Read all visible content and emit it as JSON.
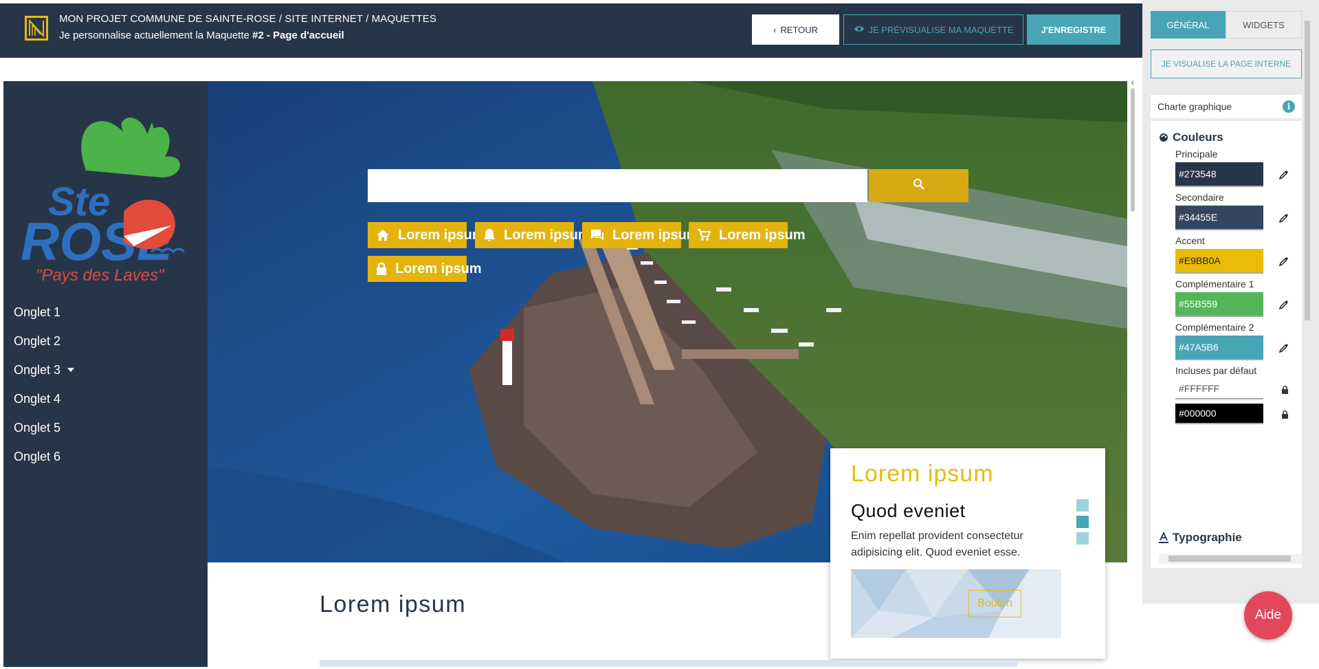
{
  "header": {
    "path": "MON PROJET COMMUNE DE SAINTE-ROSE / SITE INTERNET / MAQUETTES",
    "subtitle_prefix": "Je personnalise actuellement la Maquette ",
    "subtitle_bold": "#2 - Page d'accueil",
    "retour_label": "RETOUR",
    "preview_label": "JE PRÉVISUALISE MA MAQUETTE",
    "save_label": "J'ENREGISTRE"
  },
  "site": {
    "logo": {
      "name": "Ste ROSE",
      "tagline": "\"Pays des Laves\""
    },
    "nav": [
      "Onglet 1",
      "Onglet 2",
      "Onglet 3",
      "Onglet 4",
      "Onglet 5",
      "Onglet 6"
    ],
    "nav_dropdown_index": 2,
    "quick_links": [
      {
        "label": "Lorem ipsum",
        "icon": "home-icon"
      },
      {
        "label": "Lorem ipsum",
        "icon": "bell-icon"
      },
      {
        "label": "Lorem ipsum",
        "icon": "chat-icon"
      },
      {
        "label": "Lorem ipsum",
        "icon": "cart-icon"
      },
      {
        "label": "Lorem ipsum",
        "icon": "lock-icon"
      }
    ],
    "card": {
      "title": "Lorem ipsum",
      "subtitle": "Quod eveniet",
      "text": "Enim repellat provident consectetur adipisicing elit. Quod eveniet esse."
    },
    "section": {
      "title": "Lorem ipsum",
      "button": "Bouton"
    }
  },
  "panel": {
    "tabs": [
      "GÉNÉRAL",
      "WIDGETS"
    ],
    "active_tab": "GÉNÉRAL",
    "internal_page_button": "JE VISUALISE LA PAGE INTERNE",
    "charte_label": "Charte graphique",
    "colors_heading": "Couleurs",
    "colors": [
      {
        "label": "Principale",
        "value": "#273548"
      },
      {
        "label": "Secondaire",
        "value": "#34455E"
      },
      {
        "label": "Accent",
        "value": "#E9BB0A"
      },
      {
        "label": "Complémentaire 1",
        "value": "#55B559"
      },
      {
        "label": "Complémentaire 2",
        "value": "#47A5B6"
      }
    ],
    "defaults_label": "Incluses par défaut",
    "default_colors": [
      "#FFFFFF",
      "#000000"
    ],
    "typography_heading": "Typographie"
  },
  "help_label": "Aide"
}
